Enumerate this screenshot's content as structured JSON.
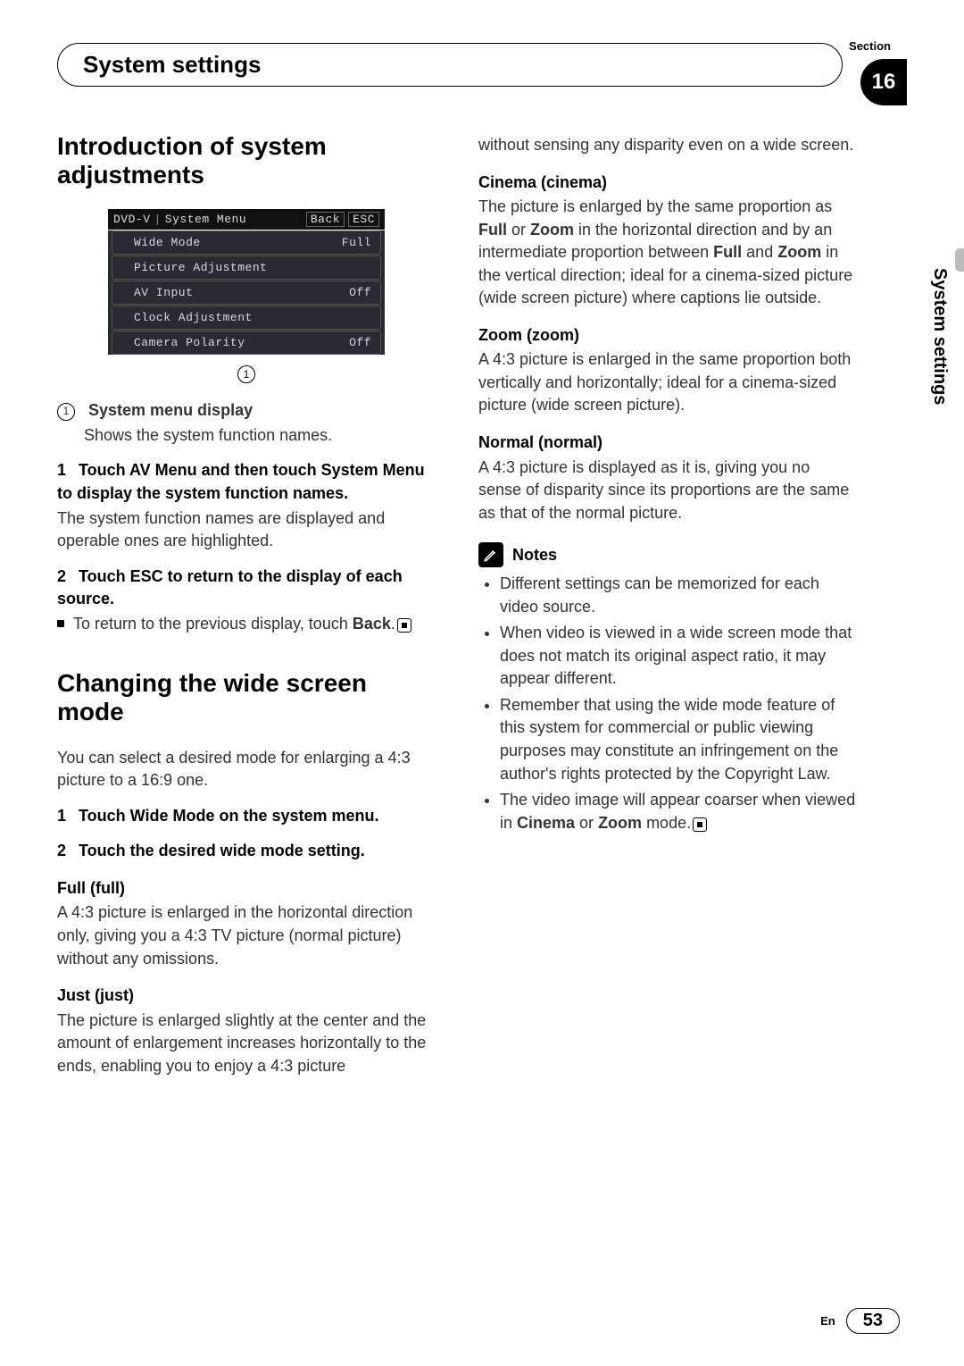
{
  "header": {
    "section_label": "Section",
    "section_number": "16",
    "title": "System settings",
    "side_tab": "System settings"
  },
  "left": {
    "h_intro": "Introduction of system adjustments",
    "screenshot": {
      "source": "DVD-V",
      "menu_title": "System Menu",
      "back": "Back",
      "esc": "ESC",
      "rows": [
        {
          "label": "Wide Mode",
          "value": "Full"
        },
        {
          "label": "Picture Adjustment",
          "value": ""
        },
        {
          "label": "AV Input",
          "value": "Off"
        },
        {
          "label": "Clock Adjustment",
          "value": ""
        },
        {
          "label": "Camera Polarity",
          "value": "Off"
        }
      ],
      "callout": "1"
    },
    "callout_title": "System menu display",
    "callout_desc": "Shows the system function names.",
    "step1_h": "Touch AV Menu and then touch System Menu to display the system function names.",
    "step1_p": "The system function names are displayed and operable ones are highlighted.",
    "step2_h": "Touch ESC to return to the display of each source.",
    "step2_li": "To return to the previous display, touch",
    "back_word": "Back",
    "h_wide": "Changing the wide screen mode",
    "wide_intro": "You can select a desired mode for enlarging a 4:3 picture to a 16:9 one.",
    "w_step1": "Touch Wide Mode on the system menu.",
    "w_step2": "Touch the desired wide mode setting.",
    "full_h": "Full (full)",
    "full_p": "A 4:3 picture is enlarged in the horizontal direction only, giving you a 4:3 TV picture (normal picture) without any omissions.",
    "just_h": "Just (just)",
    "just_p": "The picture is enlarged slightly at the center and the amount of enlargement increases horizontally to the ends, enabling you to enjoy a 4:3 picture"
  },
  "right": {
    "just_cont": "without sensing any disparity even on a wide screen.",
    "cin_h": "Cinema (cinema)",
    "cin_p1": "The picture is enlarged by the same proportion as ",
    "cin_p2": " or ",
    "cin_p3": " in the horizontal direction and by an intermediate proportion between ",
    "cin_p4": " and ",
    "cin_p5": " in the vertical direction; ideal for a cinema-sized picture (wide screen picture) where captions lie outside.",
    "b_full": "Full",
    "b_zoom": "Zoom",
    "zoom_h": "Zoom (zoom)",
    "zoom_p": "A 4:3 picture is enlarged in the same proportion both vertically and horizontally; ideal for a cinema-sized picture (wide screen picture).",
    "norm_h": "Normal (normal)",
    "norm_p": "A 4:3 picture is displayed as it is, giving you no sense of disparity since its proportions are the same as that of the normal picture.",
    "notes_title": "Notes",
    "notes": [
      "Different settings can be memorized for each video source.",
      "When video is viewed in a wide screen mode that does not match its original aspect ratio, it may appear different.",
      "Remember that using the wide mode feature of this system for commercial or public viewing purposes may constitute an infringement on the author's rights protected by the Copyright Law."
    ],
    "note_last_a": "The video image will appear coarser when viewed in ",
    "note_last_b": " or ",
    "note_last_c": " mode.",
    "b_cin": "Cinema"
  },
  "footer": {
    "lang": "En",
    "page": "53"
  }
}
